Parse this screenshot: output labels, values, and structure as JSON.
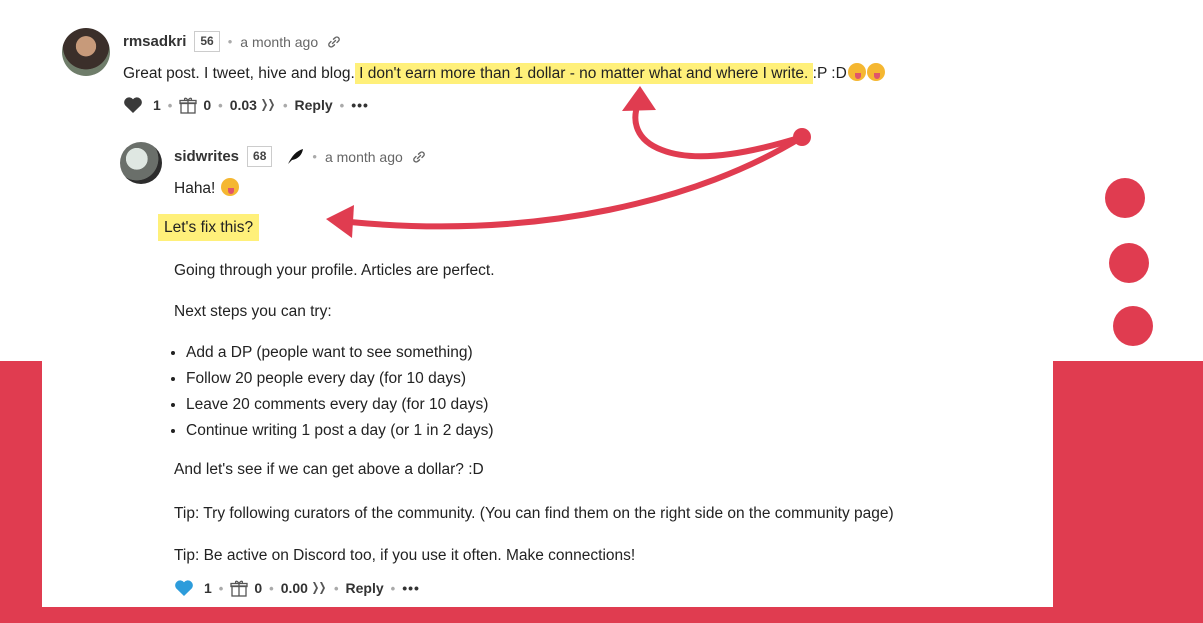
{
  "colors": {
    "accent": "#e03c50",
    "highlight": "#fff07a",
    "like_gray": "#3a3a3a",
    "like_blue": "#2d9cdb"
  },
  "comment": {
    "author": "rmsadkri",
    "reputation": "56",
    "time": "a month ago",
    "text_before": "Great post. I tweet, hive and blog.",
    "text_highlight": " I don't earn more than 1 dollar - no matter what and where I write. ",
    "text_after": ":P :D",
    "votes": "1",
    "gifts": "0",
    "payout": "0.03",
    "reply_label": "Reply",
    "more_label": "•••"
  },
  "reply": {
    "author": "sidwrites",
    "reputation": "68",
    "time": "a month ago",
    "greeting": "Haha!",
    "highlight_line": "Let's fix this?",
    "p1": "Going through your profile. Articles are perfect.",
    "p2": "Next steps you can try:",
    "steps": [
      "Add a DP (people want to see something)",
      "Follow 20 people every day (for 10 days)",
      "Leave 20 comments every day (for 10 days)",
      "Continue writing 1 post a day (or 1 in 2 days)"
    ],
    "p3": "And let's see if we can get above a dollar? :D",
    "p4": "Tip: Try following curators of the community. (You can find them on the right side on the community page)",
    "p5": "Tip: Be active on Discord too, if you use it often. Make connections!",
    "votes": "1",
    "gifts": "0",
    "payout": "0.00",
    "reply_label": "Reply",
    "more_label": "•••"
  }
}
